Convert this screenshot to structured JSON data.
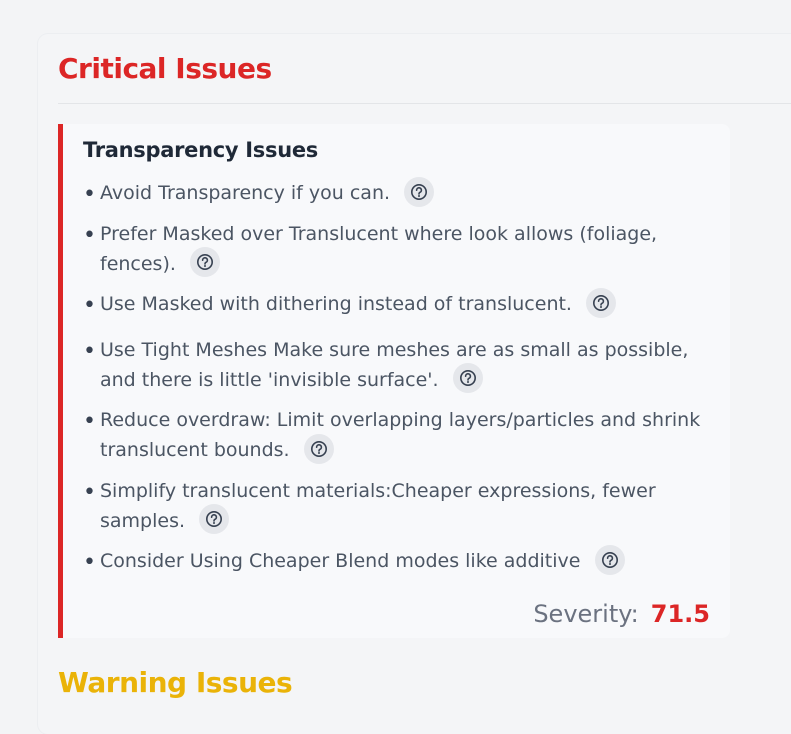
{
  "critical": {
    "title": "Critical Issues",
    "card": {
      "title": "Transparency Issues",
      "items": [
        {
          "text": "Avoid Transparency if you can."
        },
        {
          "text": "Prefer Masked over Translucent where look allows (foliage, fences)."
        },
        {
          "text": "Use Masked with dithering instead of translucent."
        },
        {
          "text": "Use Tight Meshes Make sure meshes are as small as possible, and there is little 'invisible surface'."
        },
        {
          "text": "Reduce overdraw: Limit overlapping layers/particles and shrink translucent bounds."
        },
        {
          "text": "Simplify translucent materials:Cheaper expressions, fewer samples."
        },
        {
          "text": "Consider Using Cheaper Blend modes like additive"
        }
      ],
      "severity_label": "Severity:",
      "severity_value": "71.5"
    }
  },
  "warning": {
    "title": "Warning Issues"
  },
  "colors": {
    "critical": "#dc2626",
    "warning": "#eab308"
  },
  "icons": {
    "help": "help-circle-icon"
  }
}
